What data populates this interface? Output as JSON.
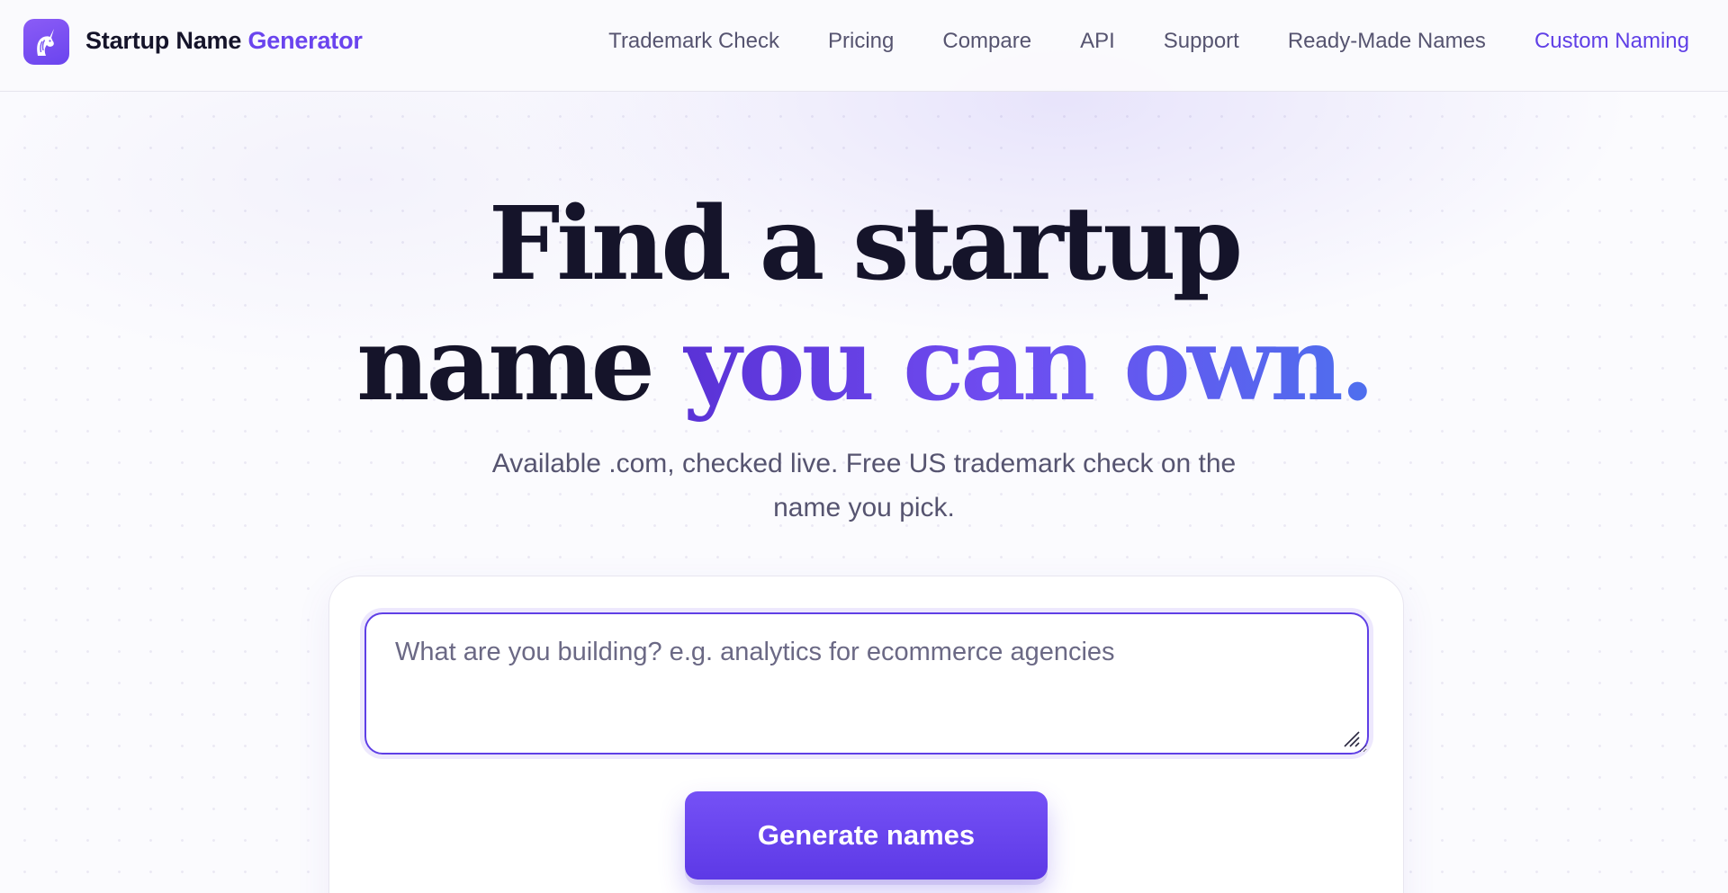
{
  "header": {
    "brand_name": "Startup Name",
    "brand_accent": "Generator",
    "logo_icon": "unicorn-icon",
    "nav": [
      {
        "label": "Trademark Check"
      },
      {
        "label": "Pricing"
      },
      {
        "label": "Compare"
      },
      {
        "label": "API"
      },
      {
        "label": "Support"
      },
      {
        "label": "Ready-Made Names"
      },
      {
        "label": "Custom Naming"
      }
    ]
  },
  "hero": {
    "headline_line1": "Find a startup",
    "headline_line2_plain": "name",
    "headline_line2_accent": "you can own.",
    "subtitle": "Available .com, checked live. Free US trademark check on the name you pick."
  },
  "form": {
    "prompt_value": "",
    "prompt_placeholder": "What are you building? e.g. analytics for ecommerce agencies",
    "submit_label": "Generate names"
  },
  "colors": {
    "accent": "#6a44ee",
    "nav_highlight": "#5f3fe6",
    "text_dark": "#15142a",
    "text_muted": "#565470"
  }
}
